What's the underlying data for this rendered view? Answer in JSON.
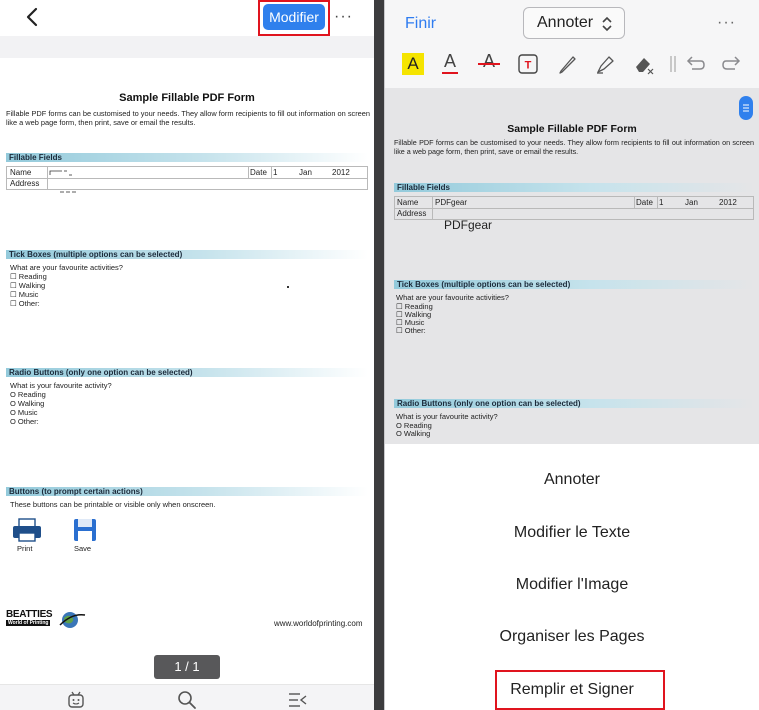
{
  "left": {
    "modify_button": "Modifier",
    "more": "···",
    "page_indicator": "1 / 1"
  },
  "form": {
    "title": "Sample Fillable PDF Form",
    "intro": "Fillable PDF forms can be customised to your needs. They allow form recipients to fill out information on screen like a web page form, then print, save or email the results.",
    "fillable_header": "Fillable Fields",
    "name_label": "Name",
    "address_label": "Address",
    "date_label": "Date",
    "date_day": "1",
    "date_month": "Jan",
    "date_year": "2012",
    "left_name_value": "",
    "right_name_value": "PDFgear",
    "right_address_overlay": "PDFgear",
    "tick_header": "Tick Boxes (multiple options can be selected)",
    "tick_question": "What are your favourite activities?",
    "tick_options": [
      "☐ Reading",
      "☐ Walking",
      "☐ Music",
      "☐ Other:"
    ],
    "radio_header": "Radio Buttons (only one option can be selected)",
    "radio_question": "What is your favourite activity?",
    "radio_options": [
      "O Reading",
      "O Walking",
      "O Music",
      "O Other:"
    ],
    "buttons_header": "Buttons (to prompt certain actions)",
    "buttons_desc": "These buttons can be printable or visible only when onscreen.",
    "print_label": "Print",
    "save_label": "Save",
    "brand_line1": "BEATTIES",
    "brand_line2": "World of Printing",
    "website": "www.worldofprinting.com"
  },
  "right": {
    "done": "Finir",
    "mode_selector": "Annoter",
    "more": "···",
    "menu": [
      "Annoter",
      "Modifier le Texte",
      "Modifier l'Image",
      "Organiser les Pages",
      "Remplir et Signer"
    ]
  },
  "colors": {
    "accent_blue": "#2f80ed",
    "highlight_red": "#e0141e",
    "highlighter_yellow": "#f5e400",
    "section_teal": "#93cadb"
  }
}
